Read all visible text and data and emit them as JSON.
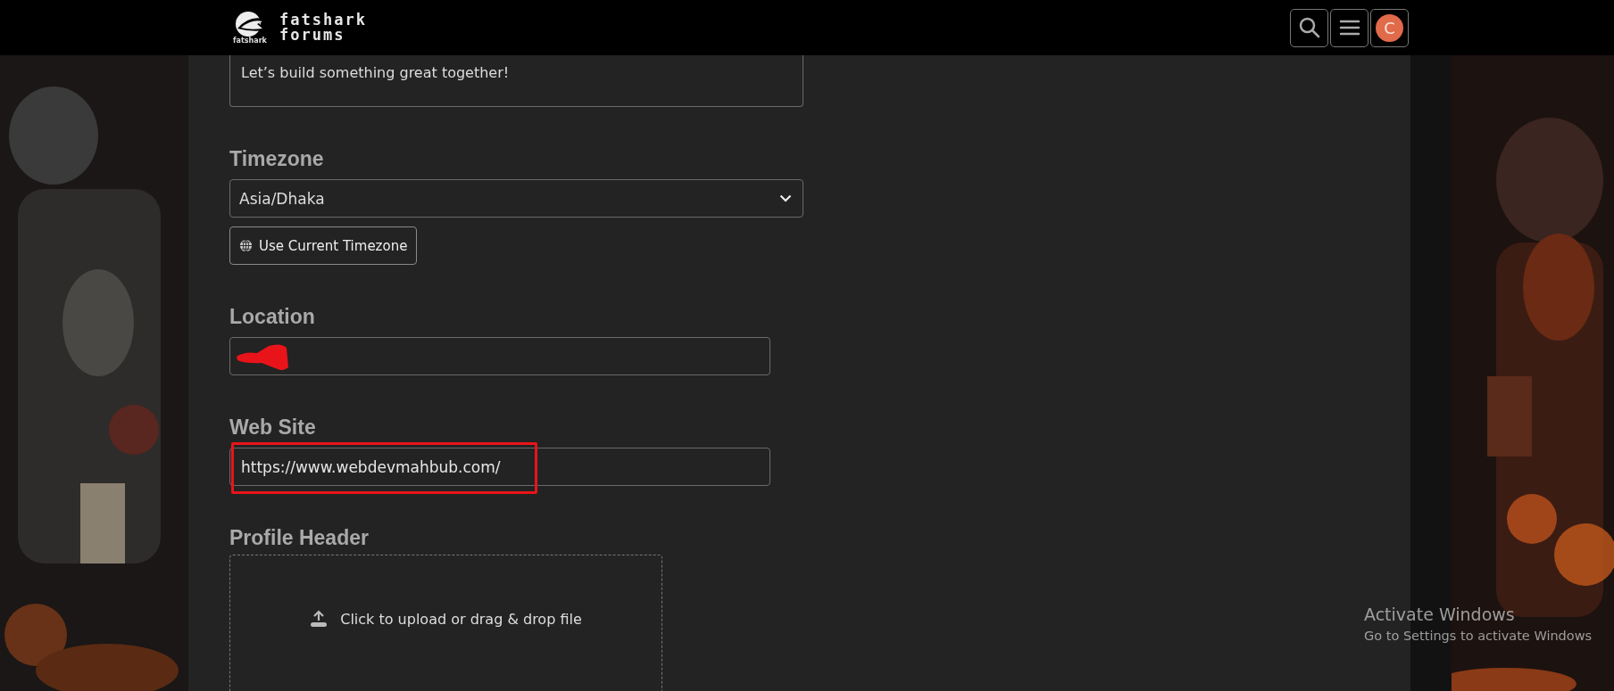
{
  "header": {
    "logo_small": "fatshark",
    "logo_line1": "fatshark",
    "logo_line2": "forums",
    "avatar_initial": "C"
  },
  "about": {
    "visible_text": "Let’s build something great together!"
  },
  "timezone": {
    "label": "Timezone",
    "value": "Asia/Dhaka",
    "button": "Use Current Timezone"
  },
  "location": {
    "label": "Location",
    "redacted": true
  },
  "website": {
    "label": "Web Site",
    "value": "https://www.webdevmahbub.com/",
    "highlighted": true
  },
  "profile_header": {
    "label": "Profile Header",
    "upload_text": "Click to upload or drag & drop file"
  },
  "os_notice": {
    "title": "Activate Windows",
    "subtitle": "Go to Settings to activate Windows"
  }
}
